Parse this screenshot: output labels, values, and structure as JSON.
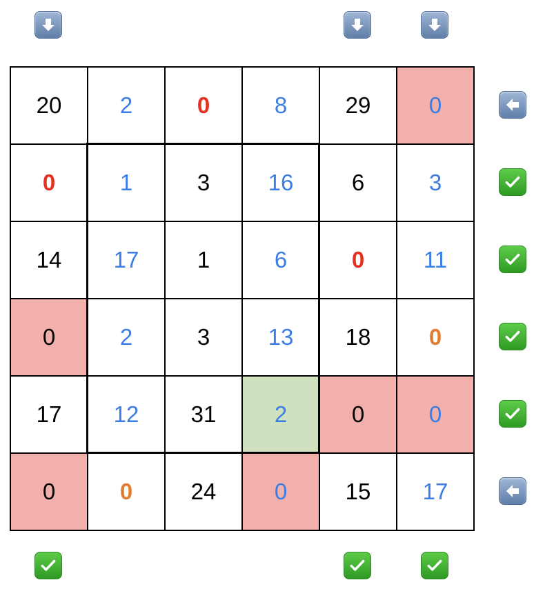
{
  "colors": {
    "black": "#000000",
    "blue": "#3a7de6",
    "red": "#e53022",
    "orange": "#e07e33",
    "highlight_red": "#f1b0ab",
    "highlight_green": "#cfe1be"
  },
  "grid": [
    [
      {
        "value": "20",
        "color": "#000000",
        "bold": false,
        "bg": "#ffffff"
      },
      {
        "value": "2",
        "color": "#3a7de6",
        "bold": false,
        "bg": "#ffffff"
      },
      {
        "value": "0",
        "color": "#e53022",
        "bold": true,
        "bg": "#ffffff"
      },
      {
        "value": "8",
        "color": "#3a7de6",
        "bold": false,
        "bg": "#ffffff"
      },
      {
        "value": "29",
        "color": "#000000",
        "bold": false,
        "bg": "#ffffff"
      },
      {
        "value": "0",
        "color": "#3a7de6",
        "bold": false,
        "bg": "#f1b0ab"
      }
    ],
    [
      {
        "value": "0",
        "color": "#e53022",
        "bold": true,
        "bg": "#ffffff"
      },
      {
        "value": "1",
        "color": "#3a7de6",
        "bold": false,
        "bg": "#ffffff"
      },
      {
        "value": "3",
        "color": "#000000",
        "bold": false,
        "bg": "#ffffff"
      },
      {
        "value": "16",
        "color": "#3a7de6",
        "bold": false,
        "bg": "#ffffff"
      },
      {
        "value": "6",
        "color": "#000000",
        "bold": false,
        "bg": "#ffffff"
      },
      {
        "value": "3",
        "color": "#3a7de6",
        "bold": false,
        "bg": "#ffffff"
      }
    ],
    [
      {
        "value": "14",
        "color": "#000000",
        "bold": false,
        "bg": "#ffffff"
      },
      {
        "value": "17",
        "color": "#3a7de6",
        "bold": false,
        "bg": "#ffffff"
      },
      {
        "value": "1",
        "color": "#000000",
        "bold": false,
        "bg": "#ffffff"
      },
      {
        "value": "6",
        "color": "#3a7de6",
        "bold": false,
        "bg": "#ffffff"
      },
      {
        "value": "0",
        "color": "#e53022",
        "bold": true,
        "bg": "#ffffff"
      },
      {
        "value": "11",
        "color": "#3a7de6",
        "bold": false,
        "bg": "#ffffff"
      }
    ],
    [
      {
        "value": "0",
        "color": "#000000",
        "bold": false,
        "bg": "#f1b0ab"
      },
      {
        "value": "2",
        "color": "#3a7de6",
        "bold": false,
        "bg": "#ffffff"
      },
      {
        "value": "3",
        "color": "#000000",
        "bold": false,
        "bg": "#ffffff"
      },
      {
        "value": "13",
        "color": "#3a7de6",
        "bold": false,
        "bg": "#ffffff"
      },
      {
        "value": "18",
        "color": "#000000",
        "bold": false,
        "bg": "#ffffff"
      },
      {
        "value": "0",
        "color": "#e07e33",
        "bold": true,
        "bg": "#ffffff"
      }
    ],
    [
      {
        "value": "17",
        "color": "#000000",
        "bold": false,
        "bg": "#ffffff"
      },
      {
        "value": "12",
        "color": "#3a7de6",
        "bold": false,
        "bg": "#ffffff"
      },
      {
        "value": "31",
        "color": "#000000",
        "bold": false,
        "bg": "#ffffff"
      },
      {
        "value": "2",
        "color": "#3a7de6",
        "bold": false,
        "bg": "#cfe1be"
      },
      {
        "value": "0",
        "color": "#000000",
        "bold": false,
        "bg": "#f1b0ab"
      },
      {
        "value": "0",
        "color": "#3a7de6",
        "bold": false,
        "bg": "#f1b0ab"
      }
    ],
    [
      {
        "value": "0",
        "color": "#000000",
        "bold": false,
        "bg": "#f1b0ab"
      },
      {
        "value": "0",
        "color": "#e07e33",
        "bold": true,
        "bg": "#ffffff"
      },
      {
        "value": "24",
        "color": "#000000",
        "bold": false,
        "bg": "#ffffff"
      },
      {
        "value": "0",
        "color": "#3a7de6",
        "bold": false,
        "bg": "#f1b0ab"
      },
      {
        "value": "15",
        "color": "#000000",
        "bold": false,
        "bg": "#ffffff"
      },
      {
        "value": "17",
        "color": "#3a7de6",
        "bold": false,
        "bg": "#ffffff"
      }
    ]
  ],
  "top_controls": [
    {
      "column": 0,
      "icon": "down-arrow-icon"
    },
    {
      "column": 4,
      "icon": "down-arrow-icon"
    },
    {
      "column": 5,
      "icon": "down-arrow-icon"
    }
  ],
  "right_controls": [
    {
      "row": 0,
      "icon": "left-arrow-icon"
    },
    {
      "row": 1,
      "icon": "check-mark-icon"
    },
    {
      "row": 2,
      "icon": "check-mark-icon"
    },
    {
      "row": 3,
      "icon": "check-mark-icon"
    },
    {
      "row": 4,
      "icon": "check-mark-icon"
    },
    {
      "row": 5,
      "icon": "left-arrow-icon"
    }
  ],
  "bottom_controls": [
    {
      "column": 0,
      "icon": "check-mark-icon"
    },
    {
      "column": 4,
      "icon": "check-mark-icon"
    },
    {
      "column": 5,
      "icon": "check-mark-icon"
    }
  ]
}
